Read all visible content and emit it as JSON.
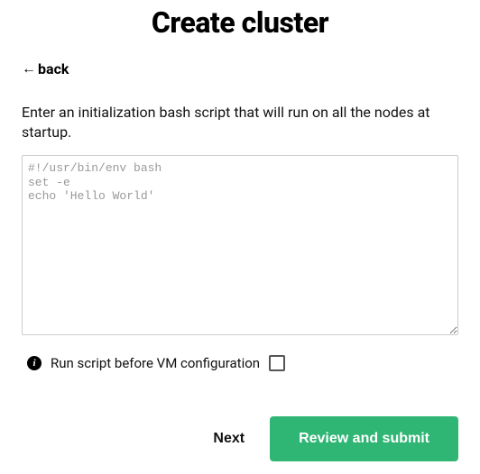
{
  "header": {
    "title": "Create cluster",
    "back_label": "back"
  },
  "main": {
    "description": "Enter an initialization bash script that will run on all the nodes at startup.",
    "script_placeholder": "#!/usr/bin/env bash\nset -e\necho 'Hello World'",
    "script_value": "",
    "run_before_label": "Run script before VM configuration",
    "run_before_checked": false
  },
  "footer": {
    "next_label": "Next",
    "submit_label": "Review and submit"
  }
}
